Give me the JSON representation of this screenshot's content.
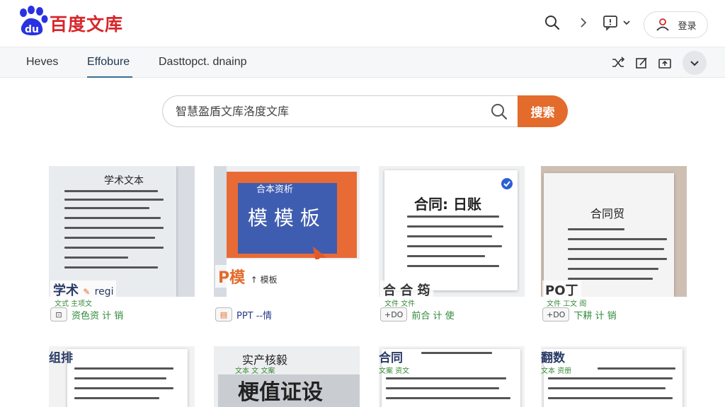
{
  "header": {
    "logo_text": "百度文库",
    "login_label": "登录"
  },
  "nav": {
    "tabs": [
      {
        "label": "Heves"
      },
      {
        "label": "Effobure"
      },
      {
        "label": "Dasttopct. dnainp"
      }
    ]
  },
  "search": {
    "placeholder": "智慧盈盾文库洛度文库",
    "button_label": "搜索"
  },
  "cards": [
    {
      "thumb_heading": "学术文本",
      "title": "学术",
      "title_extra": "regi",
      "subtitle": "文式 主项文",
      "meta_badge": "",
      "meta_text": "资色资 计 销"
    },
    {
      "thumb_heading": "合本资析",
      "thumb_big": "模 模 板",
      "title": "P模",
      "title_extra": "模板",
      "subtitle": "",
      "meta_badge": "",
      "meta_text": "PPT --情"
    },
    {
      "thumb_heading": "合同: 日账",
      "title": "合 合 筠",
      "title_extra": "",
      "subtitle": "文件 文件",
      "meta_badge": "+DO",
      "meta_text": "前合 计 使"
    },
    {
      "thumb_heading": "合同贸",
      "title": "PO丁",
      "title_extra": "",
      "subtitle": "文件 工文 阁",
      "meta_badge": "+DO",
      "meta_text": "下耕 计 销"
    },
    {
      "thumb_heading": "组排",
      "title": "组排",
      "title_extra": "",
      "subtitle": "",
      "meta_badge": "",
      "meta_text": ""
    },
    {
      "thumb_heading": "实产核毅",
      "thumb_big": "梗值证设",
      "title": "",
      "title_extra": "",
      "subtitle": "文本 文 文案",
      "meta_badge": "",
      "meta_text": ""
    },
    {
      "thumb_heading": "合同",
      "title": "合同",
      "title_extra": "",
      "subtitle": "文案 资文",
      "meta_badge": "",
      "meta_text": ""
    },
    {
      "thumb_heading": "翻数",
      "title": "翻数",
      "title_extra": "",
      "subtitle": "文本 资册",
      "meta_badge": "",
      "meta_text": ""
    }
  ],
  "colors": {
    "brand_red": "#d7262b",
    "search_orange": "#e36b2c",
    "tab_underline": "#3a6d96"
  }
}
